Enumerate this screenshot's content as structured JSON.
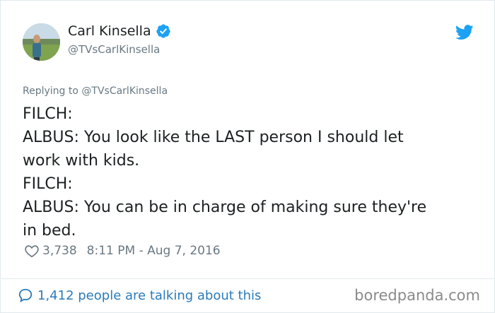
{
  "author": {
    "name": "Carl Kinsella",
    "handle": "@TVsCarlKinsella",
    "verified": true
  },
  "reply": {
    "prefix": "Replying to",
    "mention": "@TVsCarlKinsella"
  },
  "tweet": {
    "lines": [
      "FILCH:",
      "ALBUS: You look like the LAST person I should let",
      "work with kids.",
      "FILCH:",
      "ALBUS: You can be in charge of making sure they're",
      "in bed."
    ]
  },
  "meta": {
    "likes": "3,738",
    "timestamp": "8:11 PM - Aug 7, 2016"
  },
  "footer": {
    "talking": "1,412 people are talking about this",
    "watermark": "boredpanda.com"
  },
  "colors": {
    "twitter_blue": "#1da1f2",
    "link_blue": "#2b7bb9",
    "muted": "#697882"
  },
  "icons": [
    "avatar",
    "verified-icon",
    "twitter-bird-icon",
    "heart-icon",
    "speech-bubble-icon"
  ]
}
